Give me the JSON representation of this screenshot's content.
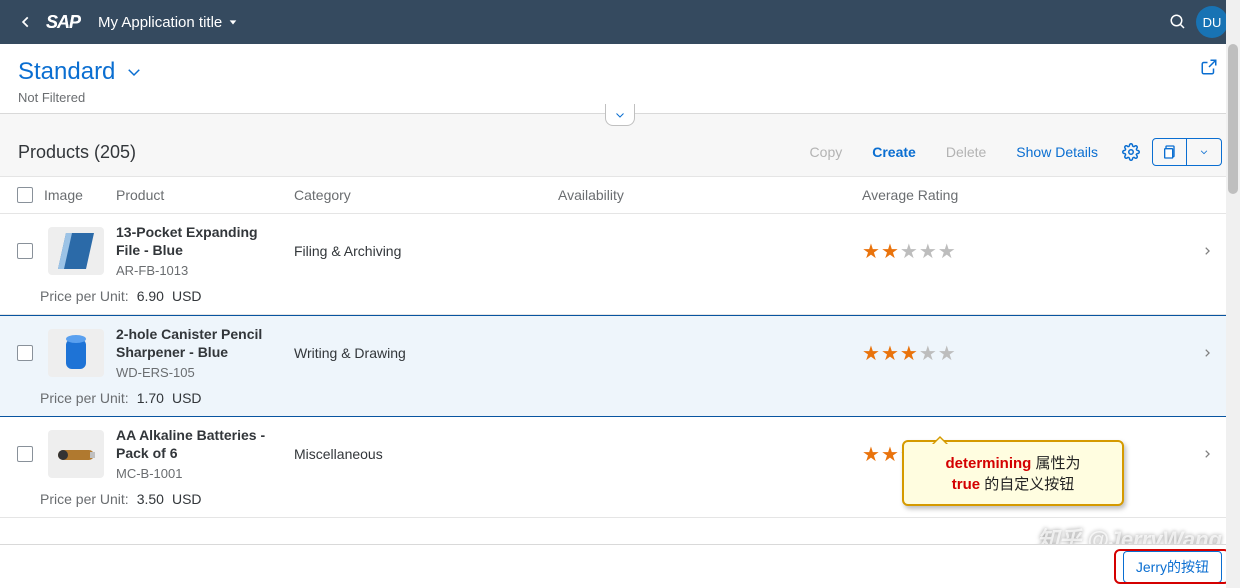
{
  "shell": {
    "logo": "SAP",
    "app_title": "My Application title",
    "avatar": "DU"
  },
  "header": {
    "variant": "Standard",
    "subtext": "Not Filtered"
  },
  "toolbar": {
    "title": "Products (205)",
    "copy": "Copy",
    "create": "Create",
    "delete": "Delete",
    "show_details": "Show Details"
  },
  "columns": {
    "image": "Image",
    "product": "Product",
    "category": "Category",
    "availability": "Availability",
    "rating": "Average Rating"
  },
  "price_label": "Price per Unit:",
  "rows": [
    {
      "name": "13-Pocket Expanding File - Blue",
      "pid": "AR-FB-1013",
      "category": "Filing & Archiving",
      "rating": 2,
      "price": "6.90",
      "currency": "USD",
      "selected": false,
      "thumb": "folder-blue"
    },
    {
      "name": "2-hole Canister Pencil Sharpener - Blue",
      "pid": "WD-ERS-105",
      "category": "Writing & Drawing",
      "rating": 3,
      "price": "1.70",
      "currency": "USD",
      "selected": true,
      "thumb": "canister-blue"
    },
    {
      "name": "AA Alkaline Batteries - Pack of 6",
      "pid": "MC-B-1001",
      "category": "Miscellaneous",
      "rating": 2,
      "price": "3.50",
      "currency": "USD",
      "selected": false,
      "thumb": "battery"
    }
  ],
  "callout": {
    "line1a": "determining",
    "line1b": " 属性为",
    "line2a": "true",
    "line2b": " 的自定义按钮"
  },
  "footer": {
    "button": "Jerry的按钮"
  },
  "watermark": "知乎 @JerryWang"
}
